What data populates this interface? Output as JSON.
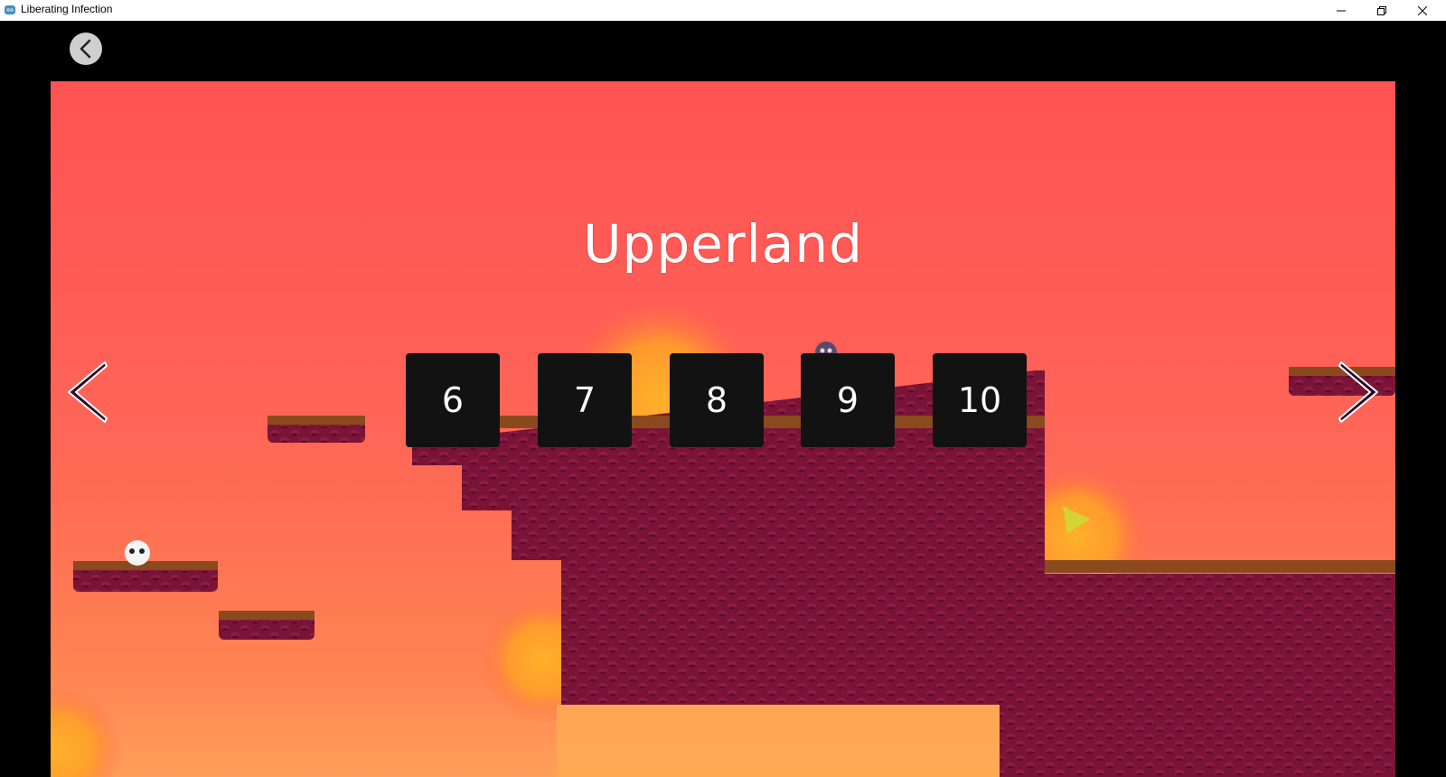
{
  "window": {
    "title": "Liberating Infection",
    "app_icon": "game-engine-icon",
    "controls": [
      "minimize-icon",
      "restore-icon",
      "close-icon"
    ]
  },
  "screen": {
    "back_icon": "chevron-left-icon",
    "world_title": "Upperland",
    "levels": [
      "6",
      "7",
      "8",
      "9",
      "10"
    ],
    "prev_icon": "chevron-left-icon",
    "next_icon": "chevron-right-icon"
  },
  "colors": {
    "sky_top": "#ff5354",
    "sky_bottom": "#ff9f5a",
    "ground": "#7a1437",
    "ground_dark": "#5c0c2a",
    "grass": "#8a4a1e",
    "sun": "#ffb22a",
    "level_button_bg": "#121212",
    "arrow_fill": "#2a0a2a"
  }
}
